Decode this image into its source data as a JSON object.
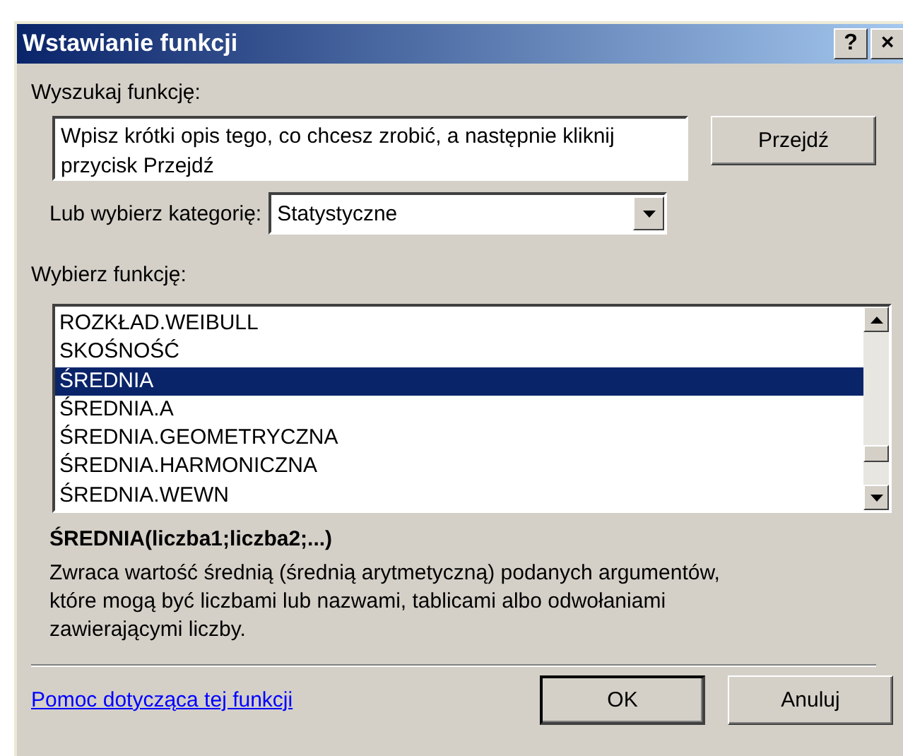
{
  "window": {
    "title": "Wstawianie funkcji",
    "title_buttons": [
      "?",
      "×"
    ]
  },
  "search": {
    "label": "Wyszukaj funkcję:",
    "value": "Wpisz krótki opis tego, co chcesz zrobić, a następnie kliknij przycisk Przejdź",
    "button": "Przejdź"
  },
  "category": {
    "label": "Lub wybierz kategorię:",
    "value": "Statystyczne"
  },
  "functions": {
    "label": "Wybierz funkcję:",
    "items": [
      {
        "label": "ROZKŁAD.WEIBULL",
        "selected": false
      },
      {
        "label": "SKOŚNOŚĆ",
        "selected": false
      },
      {
        "label": "ŚREDNIA",
        "selected": true
      },
      {
        "label": "ŚREDNIA.A",
        "selected": false
      },
      {
        "label": "ŚREDNIA.GEOMETRYCZNA",
        "selected": false
      },
      {
        "label": "ŚREDNIA.HARMONICZNA",
        "selected": false
      },
      {
        "label": "ŚREDNIA.WEWN",
        "selected": false
      }
    ]
  },
  "signature": "ŚREDNIA(liczba1;liczba2;...)",
  "description": "Zwraca wartość średnią (średnią arytmetyczną) podanych argumentów, które mogą być liczbami lub nazwami, tablicami albo odwołaniami zawierającymi liczby.",
  "help_link": "Pomoc dotycząca tej funkcji",
  "buttons": [
    {
      "label": "OK",
      "default": true
    },
    {
      "label": "Anuluj",
      "default": false
    }
  ]
}
